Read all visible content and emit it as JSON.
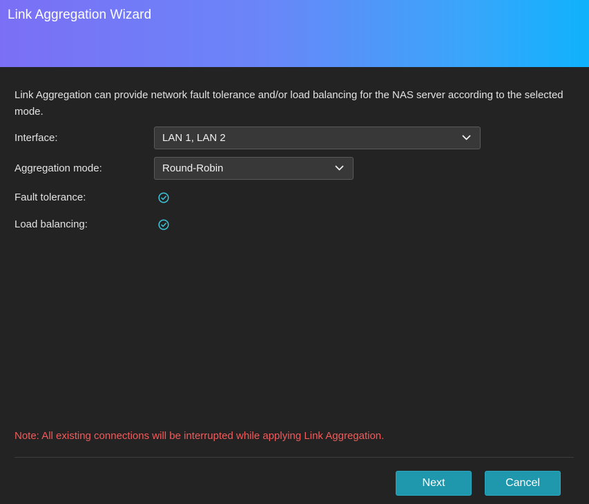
{
  "dialog": {
    "title": "Link Aggregation Wizard",
    "description": "Link Aggregation can provide network fault tolerance and/or load balancing for the NAS server according to the selected mode.",
    "interface": {
      "label": "Interface:",
      "value": "LAN 1, LAN 2"
    },
    "aggregation_mode": {
      "label": "Aggregation mode:",
      "value": "Round-Robin"
    },
    "fault_tolerance": {
      "label": "Fault tolerance:",
      "enabled": true
    },
    "load_balancing": {
      "label": "Load balancing:",
      "enabled": true
    },
    "note": "Note: All existing connections will be interrupted while applying Link Aggregation.",
    "buttons": {
      "next": "Next",
      "cancel": "Cancel"
    }
  },
  "colors": {
    "header_gradient_start": "#7b6ff6",
    "header_gradient_end": "#0fb2fc",
    "background": "#232323",
    "accent": "#1f97ad",
    "check": "#3cc6dc",
    "note": "#f25b5b"
  },
  "icons": {
    "dropdown": "chevron-down-icon",
    "enabled": "check-circle-icon"
  }
}
